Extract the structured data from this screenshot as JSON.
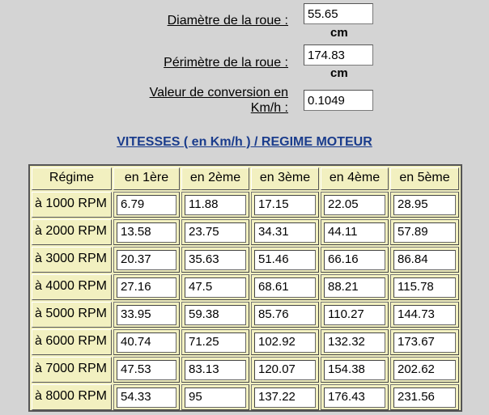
{
  "fields": {
    "diameter": {
      "label": "Diamètre de la roue :",
      "value": "55.65",
      "unit": "cm"
    },
    "perimeter": {
      "label": "Périmètre de la roue :",
      "value": "174.83",
      "unit": "cm"
    },
    "conversion": {
      "label_line1": "Valeur de conversion en",
      "label_line2": "Km/h :",
      "value": "0.1049"
    }
  },
  "section_title": "VITESSES ( en Km/h ) / REGIME MOTEUR",
  "table": {
    "headers": [
      "Régime",
      "en 1ère",
      "en 2ème",
      "en 3ème",
      "en 4ème",
      "en 5ème"
    ],
    "rows": [
      {
        "label": "à 1000 RPM",
        "values": [
          "6.79",
          "11.88",
          "17.15",
          "22.05",
          "28.95"
        ]
      },
      {
        "label": "à 2000 RPM",
        "values": [
          "13.58",
          "23.75",
          "34.31",
          "44.11",
          "57.89"
        ]
      },
      {
        "label": "à 3000 RPM",
        "values": [
          "20.37",
          "35.63",
          "51.46",
          "66.16",
          "86.84"
        ]
      },
      {
        "label": "à 4000 RPM",
        "values": [
          "27.16",
          "47.5",
          "68.61",
          "88.21",
          "115.78"
        ]
      },
      {
        "label": "à 5000 RPM",
        "values": [
          "33.95",
          "59.38",
          "85.76",
          "110.27",
          "144.73"
        ]
      },
      {
        "label": "à 6000 RPM",
        "values": [
          "40.74",
          "71.25",
          "102.92",
          "132.32",
          "173.67"
        ]
      },
      {
        "label": "à 7000 RPM",
        "values": [
          "47.53",
          "83.13",
          "120.07",
          "154.38",
          "202.62"
        ]
      },
      {
        "label": "à 8000 RPM",
        "values": [
          "54.33",
          "95",
          "137.22",
          "176.43",
          "231.56"
        ]
      }
    ]
  }
}
